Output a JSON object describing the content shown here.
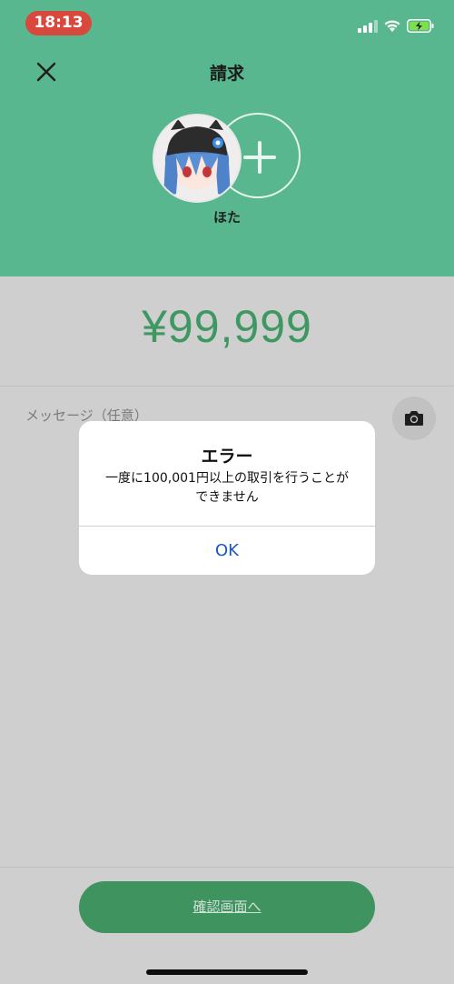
{
  "status_bar": {
    "time": "18:13"
  },
  "header": {
    "title": "請求",
    "user_name": "ほた"
  },
  "amount": "¥99,999",
  "message": {
    "placeholder": "メッセージ（任意）"
  },
  "footer": {
    "confirm_label": "確認画面へ"
  },
  "dialog": {
    "title": "エラー",
    "message_line1": "一度に100,001円以上の取引を行うことが",
    "message_line2": "できません",
    "ok_label": "OK"
  },
  "colors": {
    "header_bg": "#58b78e",
    "amount": "#3f9862",
    "button_bg": "#3f935f",
    "dialog_link": "#1b55c6",
    "time_pill": "#d9483c"
  }
}
